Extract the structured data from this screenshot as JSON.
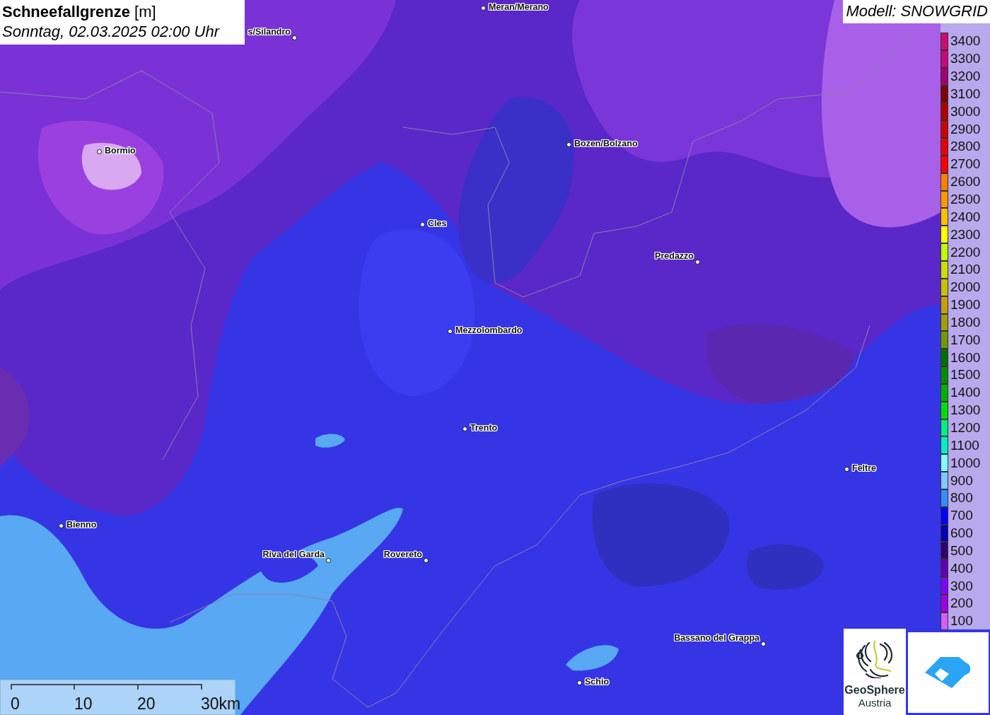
{
  "title": {
    "heading": "**Schneefallgrenze** [m]",
    "datetime": "Sonntag, 02.03.2025 02:00 Uhr"
  },
  "model_label": "Modell: SNOWGRID",
  "legend": [
    {
      "label": "3400",
      "color": "#d10a6e"
    },
    {
      "label": "3300",
      "color": "#c8087a"
    },
    {
      "label": "3200",
      "color": "#a0006e"
    },
    {
      "label": "3100",
      "color": "#800000"
    },
    {
      "label": "3000",
      "color": "#b00000"
    },
    {
      "label": "2900",
      "color": "#d00000"
    },
    {
      "label": "2800",
      "color": "#e80000"
    },
    {
      "label": "2700",
      "color": "#ff0000"
    },
    {
      "label": "2600",
      "color": "#ff8000"
    },
    {
      "label": "2500",
      "color": "#ff9900"
    },
    {
      "label": "2400",
      "color": "#ffc000"
    },
    {
      "label": "2300",
      "color": "#ffff00"
    },
    {
      "label": "2200",
      "color": "#c0ff00"
    },
    {
      "label": "2100",
      "color": "#c8e000"
    },
    {
      "label": "2000",
      "color": "#c8c000"
    },
    {
      "label": "1900",
      "color": "#c8a000"
    },
    {
      "label": "1800",
      "color": "#a0a000"
    },
    {
      "label": "1700",
      "color": "#709a00"
    },
    {
      "label": "1600",
      "color": "#007000"
    },
    {
      "label": "1500",
      "color": "#008c00"
    },
    {
      "label": "1400",
      "color": "#00b000"
    },
    {
      "label": "1300",
      "color": "#00e000"
    },
    {
      "label": "1200",
      "color": "#00f080"
    },
    {
      "label": "1100",
      "color": "#00f0c0"
    },
    {
      "label": "1000",
      "color": "#80ffff"
    },
    {
      "label": "900",
      "color": "#80c8ff"
    },
    {
      "label": "800",
      "color": "#3090ff"
    },
    {
      "label": "700",
      "color": "#0000ff"
    },
    {
      "label": "600",
      "color": "#0000b0"
    },
    {
      "label": "500",
      "color": "#300070"
    },
    {
      "label": "400",
      "color": "#6000b0"
    },
    {
      "label": "300",
      "color": "#8000ff"
    },
    {
      "label": "200",
      "color": "#a000e0"
    },
    {
      "label": "100",
      "color": "#d060ff"
    }
  ],
  "cities": [
    {
      "name": "Meran/Merano"
    },
    {
      "name": "s/Silandro"
    },
    {
      "name": "Bormio"
    },
    {
      "name": "Bozen/Bolzano"
    },
    {
      "name": "Cles"
    },
    {
      "name": "Predazzo"
    },
    {
      "name": "Mezzolombardo"
    },
    {
      "name": "Trento"
    },
    {
      "name": "Feltre"
    },
    {
      "name": "Bienno"
    },
    {
      "name": "Riva del Garda"
    },
    {
      "name": "Rovereto"
    },
    {
      "name": "Bassano del Grappa"
    },
    {
      "name": "Schio"
    }
  ],
  "scale_bar": {
    "ticks": [
      "0",
      "10",
      "20",
      "30km"
    ]
  },
  "logo": {
    "name": "GeoSphere",
    "subtitle": "Austria"
  }
}
